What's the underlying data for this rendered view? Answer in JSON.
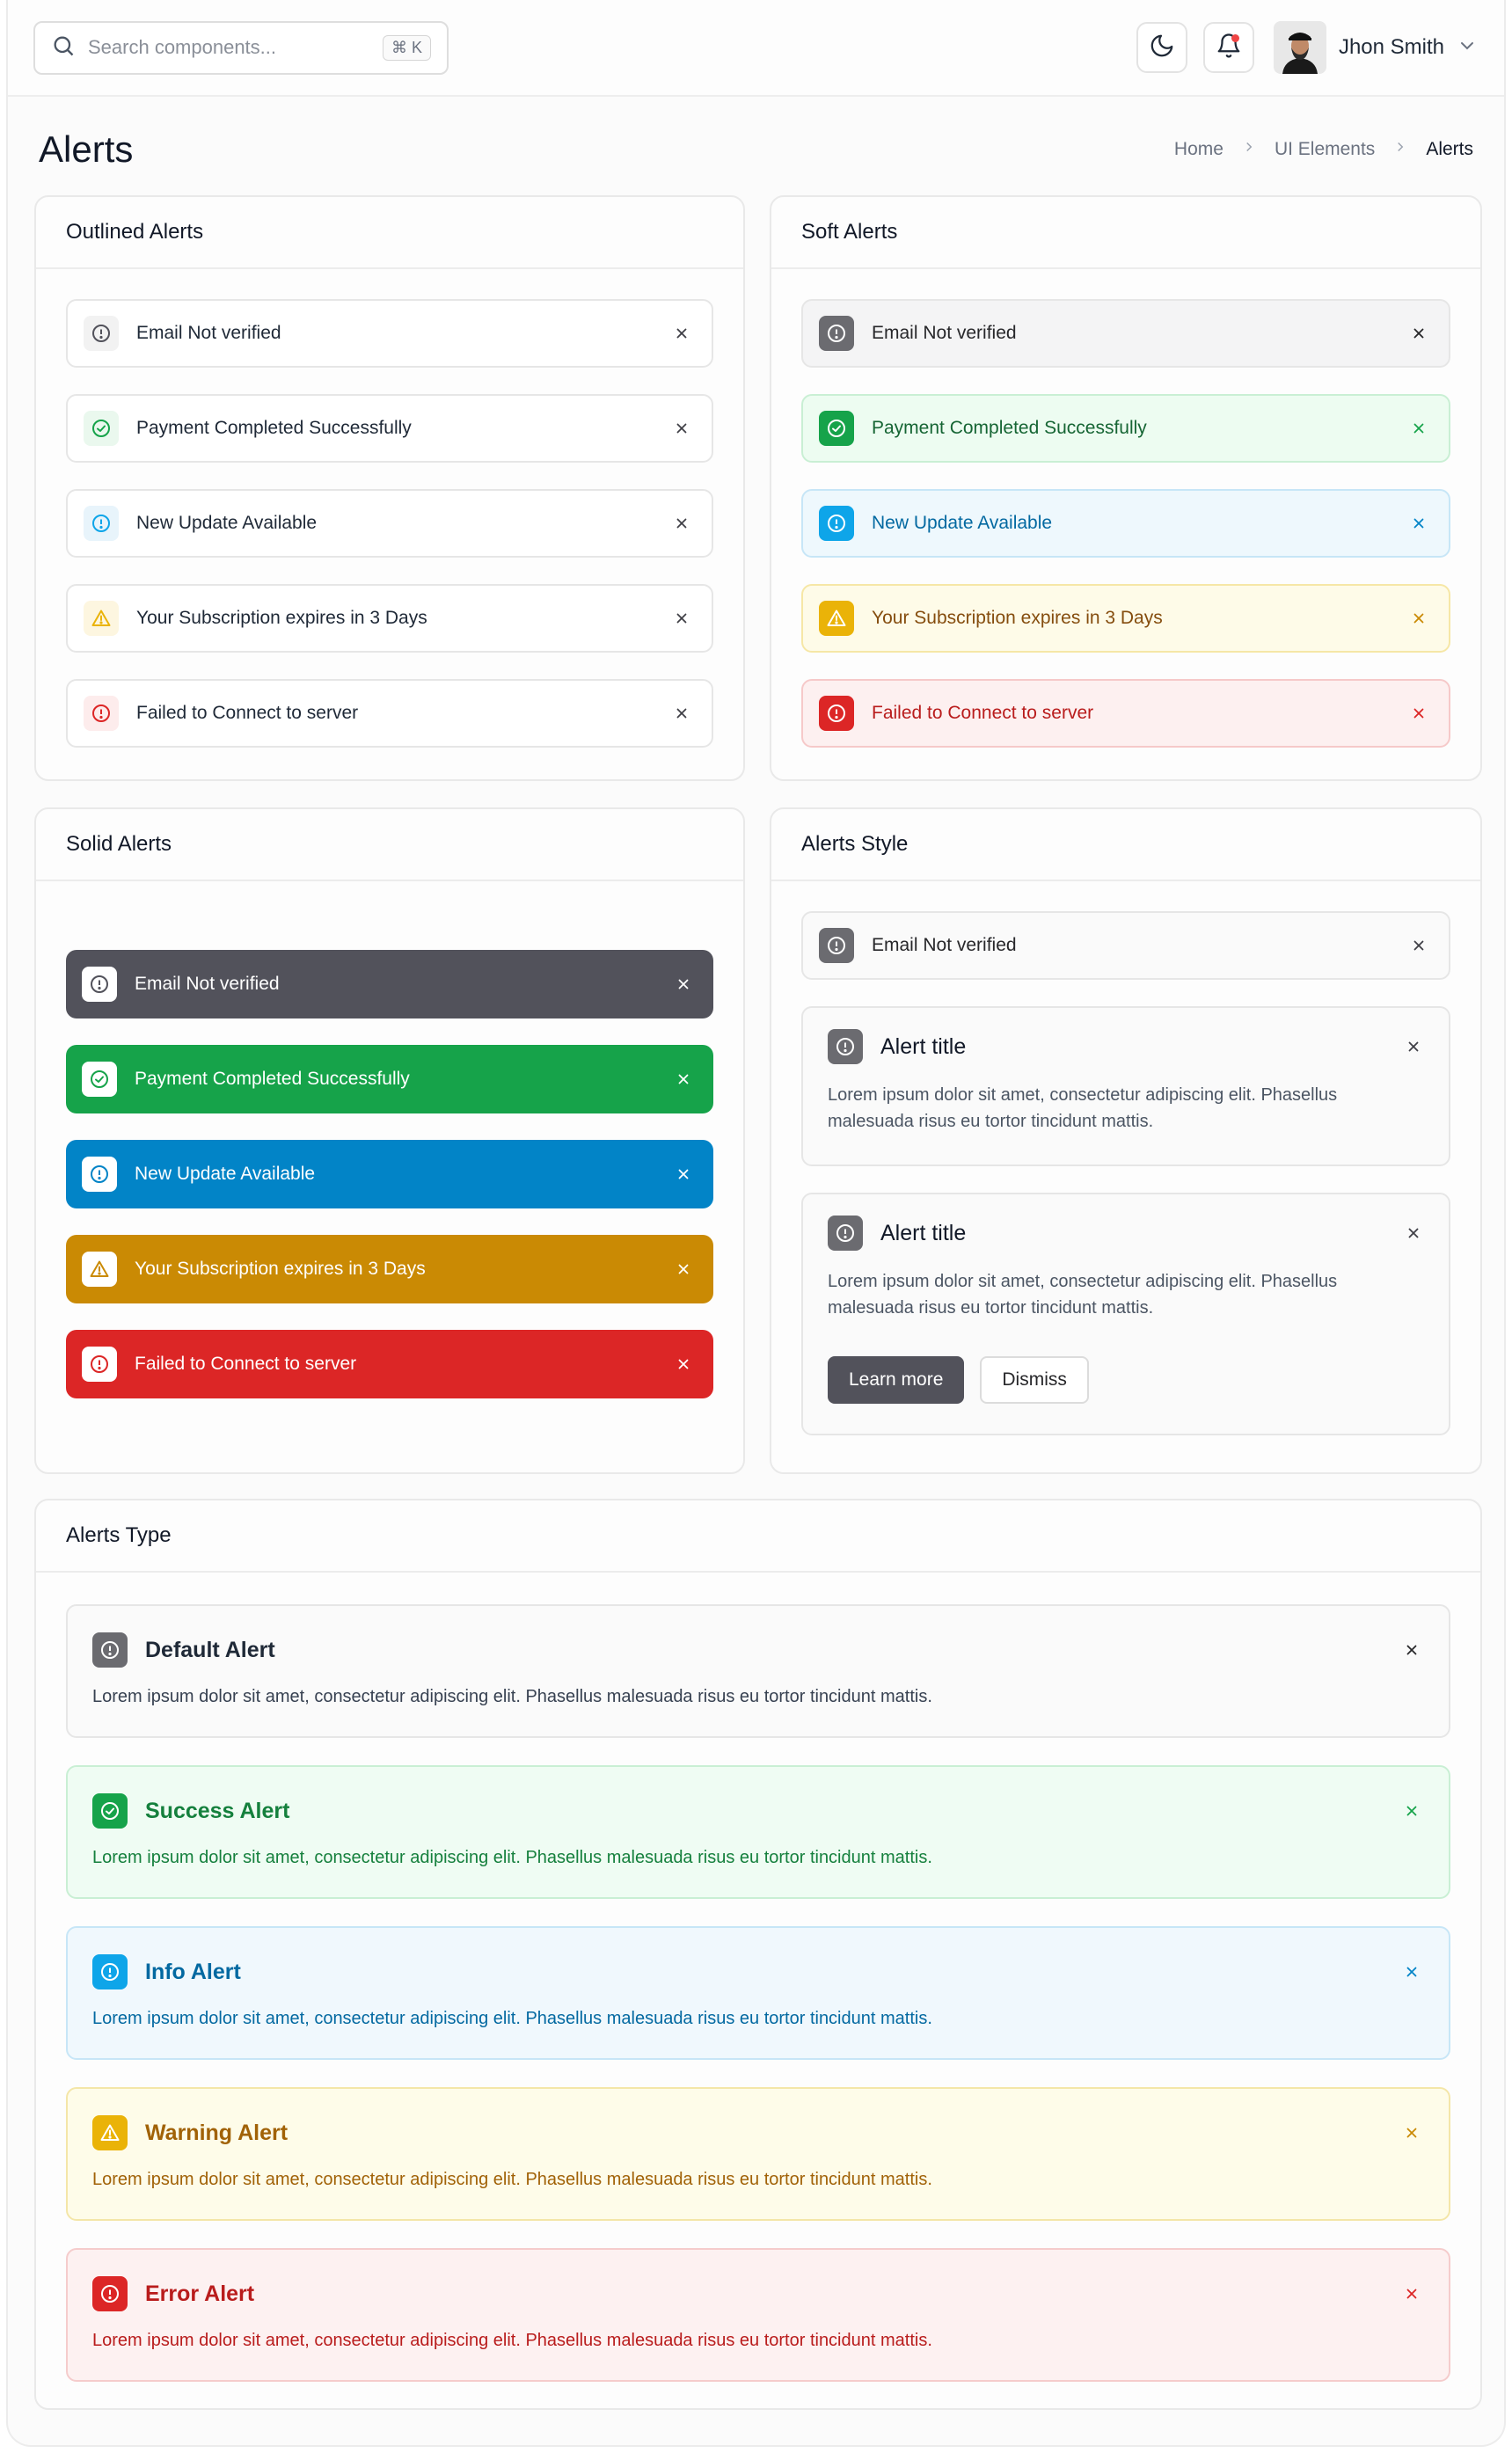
{
  "header": {
    "search_placeholder": "Search components...",
    "search_shortcut": "⌘ K",
    "user_name": "Jhon Smith"
  },
  "page": {
    "title": "Alerts",
    "breadcrumb": [
      "Home",
      "UI Elements",
      "Alerts"
    ]
  },
  "colors": {
    "gray": "#6b6b70",
    "green": "#16a34a",
    "blue": "#0ea5e9",
    "yellow": "#eab308",
    "red": "#dc2626"
  },
  "outlined": {
    "title": "Outlined Alerts",
    "items": [
      {
        "label": "Email Not verified",
        "icon": "info-circle-icon"
      },
      {
        "label": "Payment Completed Successfully",
        "icon": "check-circle-icon"
      },
      {
        "label": "New Update Available",
        "icon": "info-circle-icon"
      },
      {
        "label": "Your Subscription expires in 3 Days",
        "icon": "warning-triangle-icon"
      },
      {
        "label": "Failed to Connect to server",
        "icon": "error-circle-icon"
      }
    ]
  },
  "soft": {
    "title": "Soft Alerts",
    "items": [
      {
        "label": "Email Not verified"
      },
      {
        "label": "Payment Completed Successfully"
      },
      {
        "label": "New Update Available"
      },
      {
        "label": "Your Subscription expires in 3 Days"
      },
      {
        "label": "Failed to Connect to server"
      }
    ]
  },
  "solid": {
    "title": "Solid Alerts",
    "items": [
      {
        "label": "Email Not verified"
      },
      {
        "label": "Payment Completed Successfully"
      },
      {
        "label": "New Update Available"
      },
      {
        "label": "Your Subscription expires in 3 Days"
      },
      {
        "label": "Failed to Connect to server"
      }
    ]
  },
  "style": {
    "title": "Alerts Style",
    "simple_label": "Email Not verified",
    "box1": {
      "title": "Alert title",
      "description": "Lorem ipsum dolor sit amet, consectetur adipiscing elit. Phasellus malesuada risus eu tortor tincidunt mattis."
    },
    "box2": {
      "title": "Alert title",
      "description": "Lorem ipsum dolor sit amet, consectetur adipiscing elit. Phasellus malesuada risus eu tortor tincidunt mattis.",
      "primary_button": "Learn more",
      "secondary_button": "Dismiss"
    }
  },
  "types": {
    "title": "Alerts Type",
    "items": [
      {
        "title": "Default Alert",
        "description": "Lorem ipsum dolor sit amet, consectetur adipiscing elit. Phasellus malesuada risus eu tortor tincidunt mattis."
      },
      {
        "title": "Success Alert",
        "description": "Lorem ipsum dolor sit amet, consectetur adipiscing elit. Phasellus malesuada risus eu tortor tincidunt mattis."
      },
      {
        "title": "Info Alert",
        "description": "Lorem ipsum dolor sit amet, consectetur adipiscing elit. Phasellus malesuada risus eu tortor tincidunt mattis."
      },
      {
        "title": "Warning Alert",
        "description": "Lorem ipsum dolor sit amet, consectetur adipiscing elit. Phasellus malesuada risus eu tortor tincidunt mattis."
      },
      {
        "title": "Error Alert",
        "description": "Lorem ipsum dolor sit amet, consectetur adipiscing elit. Phasellus malesuada risus eu tortor tincidunt mattis."
      }
    ]
  }
}
